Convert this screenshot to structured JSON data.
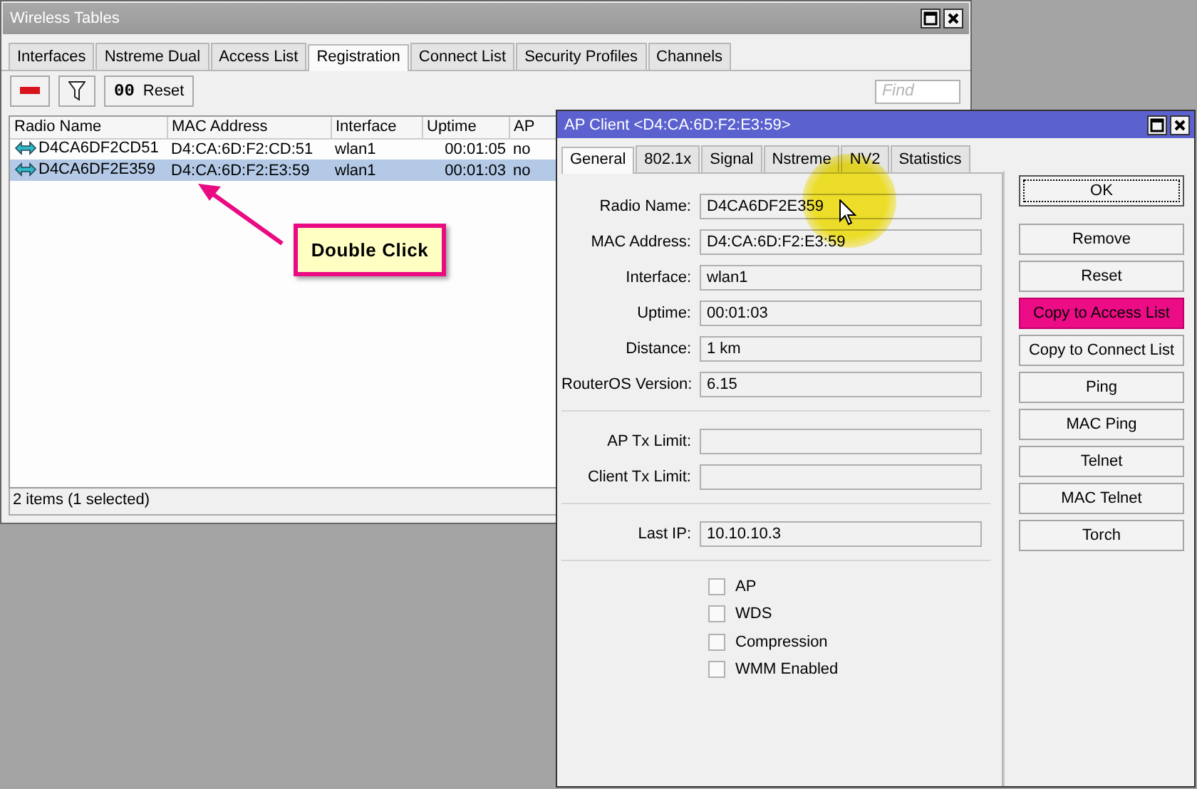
{
  "wireless_tables": {
    "title": "Wireless Tables",
    "tabs": [
      {
        "label": "Interfaces",
        "selected": false
      },
      {
        "label": "Nstreme Dual",
        "selected": false
      },
      {
        "label": "Access List",
        "selected": false
      },
      {
        "label": "Registration",
        "selected": true
      },
      {
        "label": "Connect List",
        "selected": false
      },
      {
        "label": "Security Profiles",
        "selected": false
      },
      {
        "label": "Channels",
        "selected": false
      }
    ],
    "toolbar": {
      "reset_icon": "00",
      "reset_label": "Reset"
    },
    "find": {
      "placeholder": "Find"
    },
    "table": {
      "columns": [
        "Radio Name",
        "MAC Address",
        "Interface",
        "Uptime",
        "AP"
      ],
      "rows": [
        {
          "cells": [
            "D4CA6DF2CD51",
            "D4:CA:6D:F2:CD:51",
            "wlan1",
            "00:01:05",
            "no"
          ],
          "selected": false
        },
        {
          "cells": [
            "D4CA6DF2E359",
            "D4:CA:6D:F2:E3:59",
            "wlan1",
            "00:01:03",
            "no"
          ],
          "selected": true
        }
      ]
    },
    "status_bar": "2 items (1 selected)"
  },
  "annotation": {
    "text": "Double Click"
  },
  "ap_client": {
    "title": "AP Client <D4:CA:6D:F2:E3:59>",
    "tabs": [
      {
        "label": "General",
        "selected": true
      },
      {
        "label": "802.1x",
        "selected": false
      },
      {
        "label": "Signal",
        "selected": false
      },
      {
        "label": "Nstreme",
        "selected": false
      },
      {
        "label": "NV2",
        "selected": false
      },
      {
        "label": "Statistics",
        "selected": false
      }
    ],
    "field_groups": [
      {
        "fields": [
          {
            "label": "Radio Name:",
            "value": "D4CA6DF2E359"
          },
          {
            "label": "MAC Address:",
            "value": "D4:CA:6D:F2:E3:59"
          },
          {
            "label": "Interface:",
            "value": "wlan1"
          },
          {
            "label": "Uptime:",
            "value": "00:01:03"
          },
          {
            "label": "Distance:",
            "value": "1 km"
          },
          {
            "label": "RouterOS Version:",
            "value": "6.15"
          }
        ]
      },
      {
        "fields": [
          {
            "label": "AP Tx Limit:"
          },
          {
            "label": "Client Tx Limit:"
          }
        ]
      },
      {
        "fields": [
          {
            "label": "Last IP:",
            "value": "10.10.10.3"
          }
        ]
      }
    ],
    "checkboxes": [
      {
        "label": "AP",
        "checked": false
      },
      {
        "label": "WDS",
        "checked": false
      },
      {
        "label": "Compression",
        "checked": false
      },
      {
        "label": "WMM Enabled",
        "checked": false
      }
    ],
    "buttons": [
      {
        "label": "OK",
        "focused": true,
        "highlighted": false
      },
      {
        "label": "Remove",
        "focused": false,
        "highlighted": false
      },
      {
        "label": "Reset",
        "focused": false,
        "highlighted": false
      },
      {
        "label": "Copy to Access List",
        "focused": false,
        "highlighted": true
      },
      {
        "label": "Copy to Connect List",
        "focused": false,
        "highlighted": false
      },
      {
        "label": "Ping",
        "focused": false,
        "highlighted": false
      },
      {
        "label": "MAC Ping",
        "focused": false,
        "highlighted": false
      },
      {
        "label": "Telnet",
        "focused": false,
        "highlighted": false
      },
      {
        "label": "MAC Telnet",
        "focused": false,
        "highlighted": false
      },
      {
        "label": "Torch",
        "focused": false,
        "highlighted": false
      }
    ]
  }
}
